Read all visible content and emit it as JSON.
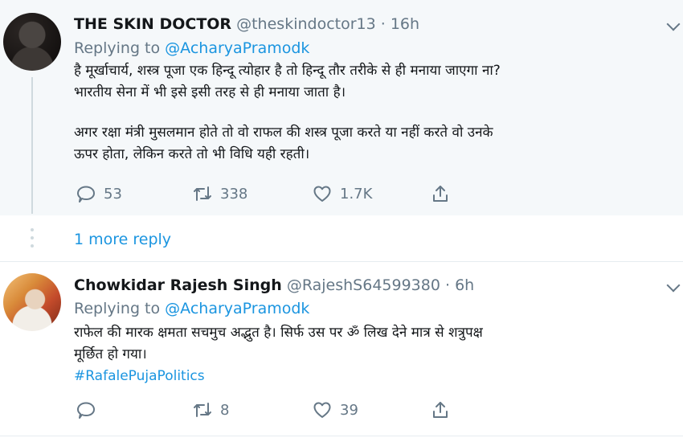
{
  "tweets": [
    {
      "name": "THE SKIN DOCTOR",
      "handle": "@theskindoctor13",
      "time": "· 16h",
      "replying_prefix": "Replying to",
      "replying_to": "@AcharyaPramodk",
      "body_lines": [
        "है मूर्खाचार्य, शस्त्र पूजा एक हिन्दू त्योहार है तो हिन्दू तौर तरीके से ही मनाया जाएगा ना?",
        "भारतीय सेना में भी इसे इसी तरह से ही मनाया जाता है।",
        "अगर रक्षा मंत्री मुसलमान होते तो वो राफल की शस्त्र पूजा करते या नहीं करते वो उनके",
        "ऊपर होता, लेकिन करते तो भी विधि यही रहती।"
      ],
      "replies": "53",
      "retweets": "338",
      "likes": "1.7K"
    },
    {
      "name": "Chowkidar Rajesh Singh",
      "handle": "@RajeshS64599380",
      "time": "· 6h",
      "replying_prefix": "Replying to",
      "replying_to": "@AcharyaPramodk",
      "body_lines": [
        "राफेल की मारक क्षमता सचमुच अद्भुत है। सिर्फ उस पर ॐ लिख देने मात्र से शत्रुपक्ष",
        "मूर्छित हो गया।"
      ],
      "hashtag": "#RafalePujaPolitics",
      "replies": "",
      "retweets": "8",
      "likes": "39"
    }
  ],
  "more_replies": "1 more reply",
  "icons": [
    "reply-icon",
    "retweet-icon",
    "like-icon",
    "share-icon",
    "chevron-down-icon"
  ],
  "colors": {
    "link": "#1b95e0",
    "muted": "#657786",
    "thread_bg": "#f5f8fa"
  }
}
